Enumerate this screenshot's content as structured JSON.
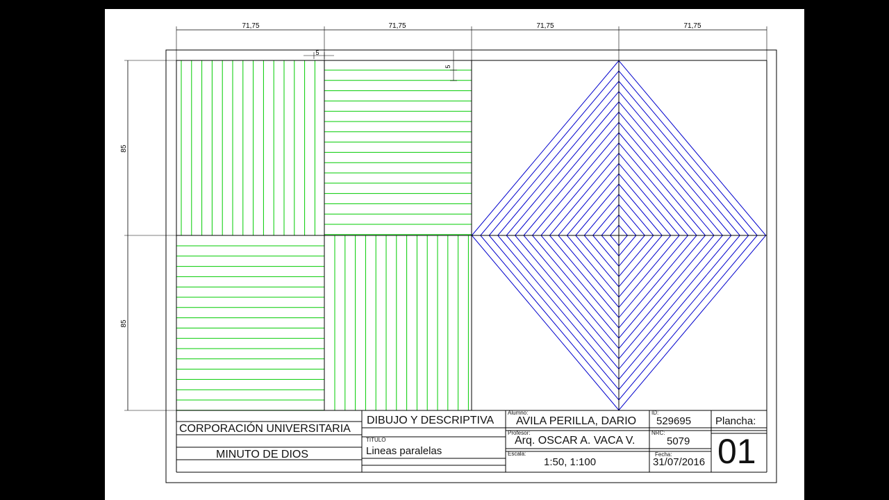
{
  "dimensions": {
    "widths": [
      "71,75",
      "71,75",
      "71,75",
      "71,75"
    ],
    "heights": [
      "85",
      "85"
    ],
    "spacing_horizontal": "5",
    "spacing_vertical": "5"
  },
  "title_block": {
    "institution_line1": "CORPORACIÓN UNIVERSITARIA",
    "institution_line2": "MINUTO DE DIOS",
    "course": "DIBUJO Y DESCRIPTIVA",
    "titulo_label": "TITULO",
    "titulo_value": "Lineas paralelas",
    "alumno_label": "Alumno:",
    "alumno_value": "AVILA PERILLA, DARIO",
    "profesor_label": "Profesor:",
    "profesor_value": "Arq. OSCAR A. VACA V.",
    "escala_label": "Escala:",
    "escala_value": "1:50, 1:100",
    "id_label": "ID:",
    "id_value": "529695",
    "nrc_label": "NRC:",
    "nrc_value": "5079",
    "fecha_label": "Fecha:",
    "fecha_value": "31/07/2016",
    "plancha_label": "Plancha:",
    "plancha_value": "01"
  },
  "colors": {
    "green_lines": "#00cc00",
    "blue_lines": "#0000cc",
    "frame": "#000000"
  }
}
